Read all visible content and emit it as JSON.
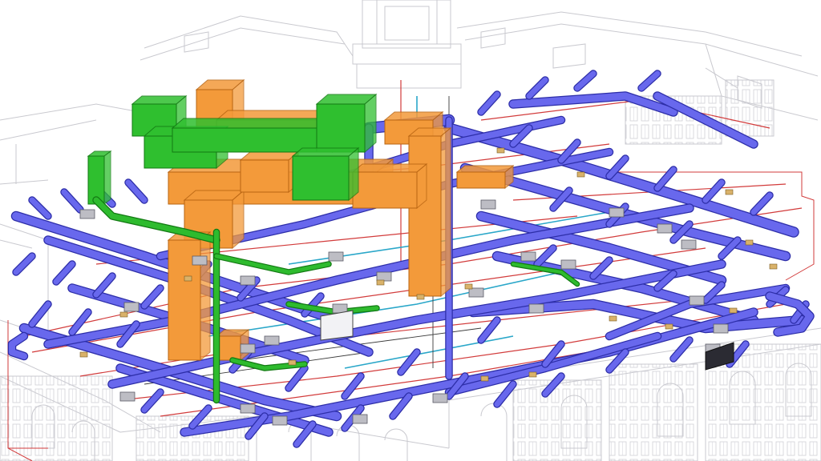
{
  "image": {
    "kind": "3D BIM render of building MEP services",
    "background_color": "#ffffff"
  },
  "palette": {
    "building_line": "#c9c9cf",
    "building_line_dark": "#a8a8b0",
    "duct_blue_fill": "#6b6cf0",
    "duct_blue_edge": "#2d2ea8",
    "duct_orange_fill": "#f39a3a",
    "duct_orange_edge": "#b86412",
    "duct_green_fill": "#2fbf2f",
    "duct_green_edge": "#137a13",
    "pipe_red": "#d23b3b",
    "pipe_cyan": "#2aa7c9",
    "pipe_dark": "#3a3a3a",
    "diffuser": "#d9b26a"
  },
  "layers": [
    {
      "name": "building-shell",
      "icon": "building-outline-icon"
    },
    {
      "name": "supply-ductwork",
      "color_key": "duct_blue_fill"
    },
    {
      "name": "exhaust-ductwork",
      "color_key": "duct_orange_fill"
    },
    {
      "name": "fresh-air-ductwork",
      "color_key": "duct_green_fill"
    },
    {
      "name": "piping",
      "color_key": "pipe_red"
    }
  ]
}
